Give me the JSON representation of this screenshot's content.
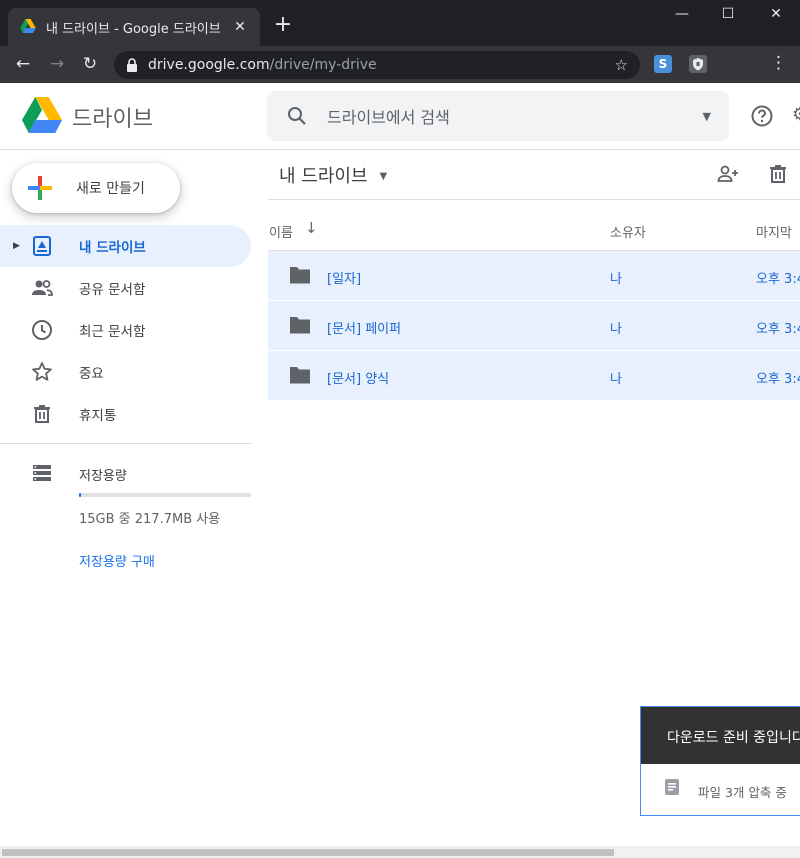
{
  "browser": {
    "tab_title": "내 드라이브 - Google 드라이브",
    "tab_close": "✕",
    "new_tab": "+",
    "url_host": "drive.google.com",
    "url_path": "/drive/my-drive",
    "ext1_label": "S"
  },
  "header": {
    "app_name": "드라이브",
    "search_placeholder": "드라이브에서 검색"
  },
  "sidebar": {
    "new_label": "새로 만들기",
    "items": [
      {
        "label": "내 드라이브",
        "icon": "my-drive-icon",
        "active": true
      },
      {
        "label": "공유 문서함",
        "icon": "shared-icon",
        "active": false
      },
      {
        "label": "최근 문서함",
        "icon": "clock-icon",
        "active": false
      },
      {
        "label": "중요",
        "icon": "star-icon",
        "active": false
      },
      {
        "label": "휴지통",
        "icon": "trash-icon",
        "active": false
      }
    ],
    "storage": {
      "label": "저장용량",
      "usage": "15GB 중 217.7MB 사용",
      "fraction_used": 0.014,
      "buy_label": "저장용량 구매"
    }
  },
  "main": {
    "title": "내 드라이브",
    "columns": {
      "name": "이름",
      "owner": "소유자",
      "modified": "마지막"
    },
    "rows": [
      {
        "name": "[일자]",
        "owner": "나",
        "modified": "오후 3:4"
      },
      {
        "name": "[문서] 페이퍼",
        "owner": "나",
        "modified": "오후 3:4"
      },
      {
        "name": "[문서] 양식",
        "owner": "나",
        "modified": "오후 3:4"
      }
    ]
  },
  "toast": {
    "title": "다운로드 준비 중입니다",
    "status": "파일 3개 압축 중"
  },
  "colors": {
    "accent": "#1a73e8",
    "selected_bg": "#e8f0fe",
    "chrome_dark": "#202124"
  }
}
